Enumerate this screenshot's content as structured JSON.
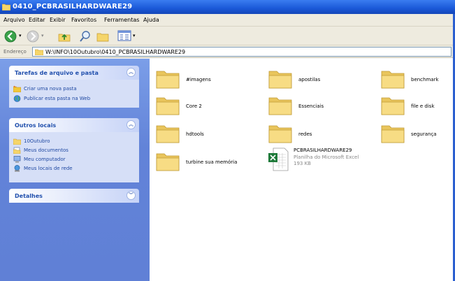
{
  "window": {
    "title": "0410_PCBRASILHARDWARE29"
  },
  "menu": [
    "Arquivo",
    "Editar",
    "Exibir",
    "Favoritos",
    "Ferramentas",
    "Ajuda"
  ],
  "address": {
    "label": "Endereço",
    "path": "W:\\INFO\\10Outubro\\0410_PCBRASILHARDWARE29"
  },
  "tasks_panel": {
    "title": "Tarefas de arquivo e pasta",
    "items": [
      {
        "label": "Criar uma nova pasta",
        "icon": "new-folder-icon"
      },
      {
        "label": "Publicar esta pasta na Web",
        "icon": "globe-icon"
      }
    ]
  },
  "places_panel": {
    "title": "Outros locais",
    "items": [
      {
        "label": "10Outubro",
        "icon": "folder-icon"
      },
      {
        "label": "Meus documentos",
        "icon": "documents-icon"
      },
      {
        "label": "Meu computador",
        "icon": "computer-icon"
      },
      {
        "label": "Meus locais de rede",
        "icon": "network-icon"
      }
    ]
  },
  "details_panel": {
    "title": "Detalhes"
  },
  "folders": [
    "#imagens",
    "apostilas",
    "benchmark",
    "Core 2",
    "Essenciais",
    "file e disk",
    "hdtools",
    "redes",
    "segurança",
    "turbine sua memória"
  ],
  "file": {
    "name": "PCBRASILHARDWARE29",
    "type": "Planilha do Microsoft Excel",
    "size": "193 KB",
    "icon": "excel-icon"
  },
  "colors": {
    "titlebar": "#1a58d8",
    "taskpane": "#6283d8",
    "folder": "#f2d77a"
  }
}
